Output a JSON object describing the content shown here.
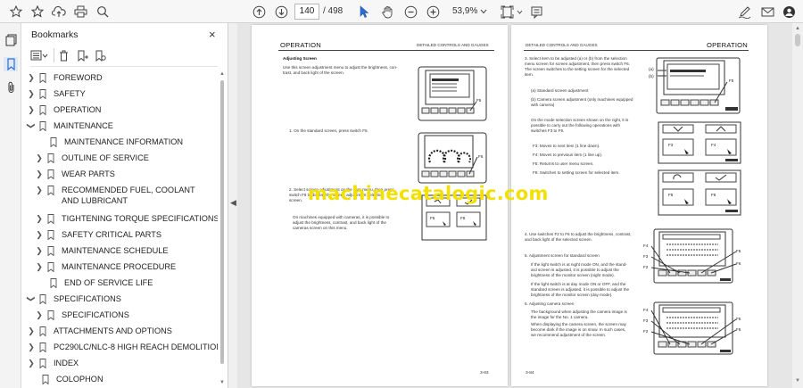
{
  "toolbar": {
    "current_page": "140",
    "total_pages": "/ 498",
    "zoom": "53,9%"
  },
  "panel": {
    "title": "Bookmarks",
    "close": "×"
  },
  "bookmarks": [
    {
      "label": "FOREWORD",
      "level": 0,
      "expanded": false
    },
    {
      "label": "SAFETY",
      "level": 0,
      "expanded": false
    },
    {
      "label": "OPERATION",
      "level": 0,
      "expanded": false
    },
    {
      "label": "MAINTENANCE",
      "level": 0,
      "expanded": true
    },
    {
      "label": "MAINTENANCE INFORMATION",
      "level": 1,
      "expanded": null
    },
    {
      "label": "OUTLINE OF SERVICE",
      "level": 1,
      "expanded": false
    },
    {
      "label": "WEAR PARTS",
      "level": 1,
      "expanded": false
    },
    {
      "label": "RECOMMENDED FUEL, COOLANT AND LUBRICANT",
      "level": 1,
      "expanded": false
    },
    {
      "label": "TIGHTENING TORQUE SPECIFICATIONS",
      "level": 1,
      "expanded": false
    },
    {
      "label": "SAFETY CRITICAL PARTS",
      "level": 1,
      "expanded": false
    },
    {
      "label": "MAINTENANCE SCHEDULE",
      "level": 1,
      "expanded": false
    },
    {
      "label": "MAINTENANCE PROCEDURE",
      "level": 1,
      "expanded": false
    },
    {
      "label": "END OF SERVICE LIFE",
      "level": 1,
      "expanded": null
    },
    {
      "label": "SPECIFICATIONS",
      "level": 0,
      "expanded": true
    },
    {
      "label": "SPECIFICATIONS",
      "level": 1,
      "expanded": false
    },
    {
      "label": "ATTACHMENTS AND OPTIONS",
      "level": 0,
      "expanded": false
    },
    {
      "label": "PC290LC/NLC-8 HIGH REACH DEMOLITION",
      "level": 0,
      "expanded": false
    },
    {
      "label": "INDEX",
      "level": 0,
      "expanded": false
    },
    {
      "label": "COLOPHON",
      "level": 0,
      "expanded": null
    }
  ],
  "left_page": {
    "header_title": "OPERATION",
    "header_sub": "DETAILED CONTROLS AND GAUGES",
    "section_title": "Adjusting Screen",
    "intro": [
      "Use this screen adjustment menu to adjust the brightness, con-",
      "trast, and back light of the screen."
    ],
    "step1": "1.   On the standard screen, press switch F5.",
    "step2": [
      "2.   Select screen adjustment on the user menu, then press",
      "      switch F6 to display the screen adjustment selection",
      "      screen."
    ],
    "note": [
      "      On machines equipped with cameras, it is possible to",
      "      adjust the brightness, contrast, and back light of the",
      "      cameras screen on this menu."
    ],
    "page_number": "3-83",
    "fig_labels": {
      "f5a": "F5",
      "f5b": "F5",
      "f5c": "F5",
      "f6": "F6"
    }
  },
  "right_page": {
    "header_title": "OPERATION",
    "header_sub": "DETAILED CONTROLS AND GAUGES",
    "step3": [
      "3.   Select item to be adjusted (a) or (b) from the selection",
      "      menu screen for screen adjustment, then press switch F6.",
      "      The screen switches to the setting screen for the selected",
      "      item."
    ],
    "items": [
      "(a)  Standard screen adjustment",
      "(b)  Camera screen adjustment (only machines equipped",
      "      with camera)"
    ],
    "mode_note": [
      "      On the mode selection screen shown on the right, it is",
      "      possible to carry out the following operations with",
      "      switches F3 to F6."
    ],
    "switches": [
      "F3: Moves to next item (1 line down).",
      "F4: Moves to previous item (1 line up).",
      "F5: Returns to user menu screen.",
      "F6: Switches to setting screen for selected item."
    ],
    "step4": [
      "4.   Use switches F2 to F6 to adjust the brightness, contrast,",
      "      and back light of the selected screen."
    ],
    "step5": "5.   Adjustment screen for standard screen",
    "step5_notes": [
      "      If the light switch is at night mode ON, and the stand-",
      "      ard screen is adjusted, it is possible to adjust the",
      "      brightness of the monitor screen (night mode).",
      "      If the light switch is at day mode ON or OFF, and the",
      "      standard screen is adjusted, it is possible to adjust the",
      "      brightness of the monitor screen (day mode)."
    ],
    "step6": "6.   Adjusting camera screen",
    "step6_notes": [
      "      The background when adjusting the camera image is",
      "      the image for the No. 1 camera.",
      "      When displaying the camera screen, the screen may",
      "      become dark if the image is on snow. In such cases,",
      "      we recommend adjustment of the screen."
    ],
    "page_number": "3-84",
    "fig_labels": {
      "a": "(a)",
      "b": "(b)",
      "f5": "F5",
      "f3": "F3",
      "f4": "F4",
      "f5b": "F5",
      "f6": "F6",
      "f4b": "F4",
      "f3b": "F3",
      "f2": "F2",
      "f5c": "F5",
      "f6b": "F6",
      "f4c": "F4",
      "f3c": "F3",
      "f2b": "F2",
      "f5d": "F5",
      "f6c": "F6"
    }
  },
  "watermark": "machinecatalogic.com",
  "colors": {
    "watermark": "#f2e100",
    "accent": "#2a6fd6"
  }
}
